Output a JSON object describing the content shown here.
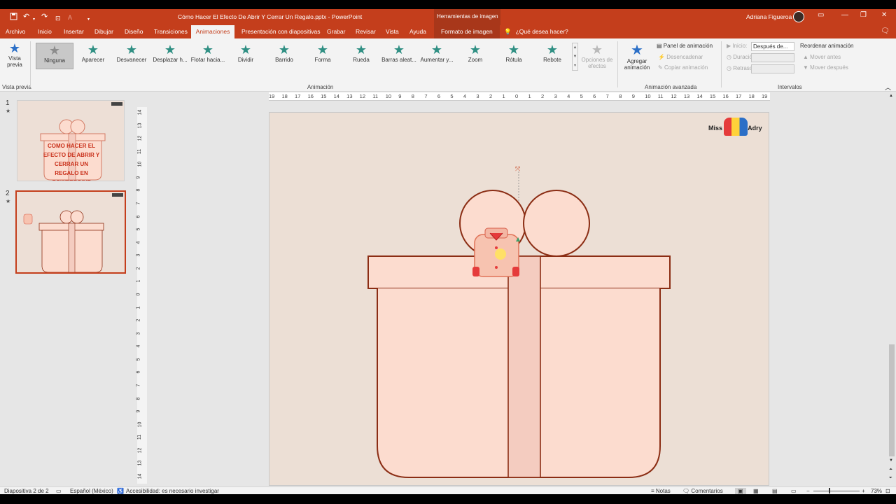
{
  "title_bar": {
    "document_title": "Cómo Hacer El Efecto De Abrir Y Cerrar Un Regalo.pptx  -  PowerPoint",
    "context_tab": "Herramientas de imagen",
    "user_name": "Adriana Figueroa",
    "qa_icons": [
      "save-icon",
      "undo-icon",
      "redo-icon",
      "start-from-beginning-icon",
      "font-color-icon",
      "customize-icon"
    ],
    "window_icons": [
      "ribbon-display-icon",
      "minimize-icon",
      "restore-icon",
      "close-icon"
    ],
    "bar_color": "#c43e1c"
  },
  "tabs": [
    "Archivo",
    "Inicio",
    "Insertar",
    "Dibujar",
    "Diseño",
    "Transiciones",
    "Animaciones",
    "Presentación con diapositivas",
    "Grabar",
    "Revisar",
    "Vista",
    "Ayuda"
  ],
  "active_tab": "Animaciones",
  "format_tab": "Formato de imagen",
  "tell_me": "¿Qué desea hacer?",
  "ribbon": {
    "preview_label": "Vista previa",
    "preview_group": "Vista previa",
    "animations": [
      "Ninguna",
      "Aparecer",
      "Desvanecer",
      "Desplazar h...",
      "Flotar hacia...",
      "Dividir",
      "Barrido",
      "Forma",
      "Rueda",
      "Barras aleat...",
      "Aumentar y...",
      "Zoom",
      "Rótula",
      "Rebote"
    ],
    "selected_animation": "Ninguna",
    "effect_options": "Opciones de efectos",
    "animation_group": "Animación",
    "add_animation": "Agregar animación",
    "animation_pane": "Panel de animación",
    "trigger": "Desencadenar",
    "copy_animation": "Copiar animación",
    "advanced_group": "Animación avanzada",
    "start_label": "Inicio:",
    "start_value": "Después de...",
    "duration_label": "Duración:",
    "delay_label": "Retraso:",
    "reorder_title": "Reordenar animación",
    "move_earlier": "Mover antes",
    "move_later": "Mover después",
    "timing_group": "Intervalos",
    "accent_color": "#2f8f83"
  },
  "thumbnails": [
    {
      "number": "1",
      "text": "COMO HACER EL EFECTO DE ABRIR Y CERRAR UN REGALO EN POWERPOINT"
    },
    {
      "number": "2",
      "text": ""
    }
  ],
  "hruler_ticks": [
    "19",
    "18",
    "17",
    "16",
    "15",
    "14",
    "13",
    "12",
    "11",
    "10",
    "9",
    "8",
    "7",
    "6",
    "5",
    "4",
    "3",
    "2",
    "1",
    "0",
    "1",
    "2",
    "3",
    "4",
    "5",
    "6",
    "7",
    "8",
    "9",
    "10",
    "11",
    "12",
    "13",
    "14",
    "15",
    "16",
    "17",
    "18",
    "19"
  ],
  "vruler_ticks": [
    "14",
    "13",
    "12",
    "11",
    "10",
    "9",
    "8",
    "7",
    "6",
    "5",
    "4",
    "3",
    "2",
    "1",
    "0",
    "1",
    "2",
    "3",
    "4",
    "5",
    "6",
    "7",
    "8",
    "9",
    "10",
    "11",
    "12",
    "13",
    "14"
  ],
  "slide": {
    "logo": "Miss Adry",
    "gift_colors": {
      "box": "#fcdccf",
      "stroke": "#8b2d14",
      "ribbon": "#f4ccc0"
    }
  },
  "status": {
    "slide_info": "Diapositiva 2 de 2",
    "language": "Español (México)",
    "accessibility": "Accesibilidad: es necesario investigar",
    "notes": "Notas",
    "comments": "Comentarios",
    "zoom": "73%"
  }
}
